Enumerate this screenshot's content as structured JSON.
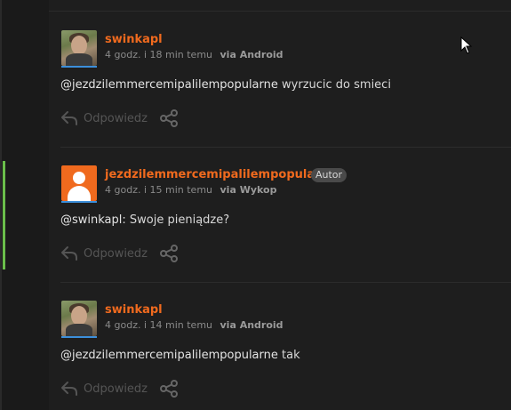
{
  "comments": [
    {
      "username": "swinkapl",
      "time": "4 godz. i 18 min temu",
      "via": "via Android",
      "mention": "@jezdzilemmercemipalilempopularne",
      "text": " wyrzucic do smieci",
      "badge": "",
      "avatar": "photo",
      "reply_label": "Odpowiedz"
    },
    {
      "username": "jezdzilemmercemipalilempopularne",
      "time": "4 godz. i 15 min temu",
      "via": "via Wykop",
      "mention": "@swinkapl",
      "text": ": Swoje pieniądze?",
      "badge": "Autor",
      "avatar": "default",
      "reply_label": "Odpowiedz"
    },
    {
      "username": "swinkapl",
      "time": "4 godz. i 14 min temu",
      "via": "via Android",
      "mention": "@jezdzilemmercemipalilempopularne",
      "text": " tak",
      "badge": "",
      "avatar": "photo",
      "reply_label": "Odpowiedz"
    }
  ],
  "icons": {
    "reply": "reply-arrow-icon",
    "share": "share-icon",
    "cursor": "mouse-pointer-icon"
  },
  "colors": {
    "username": "#f06a1e",
    "highlight": "#6abf4b",
    "avatar_underline": "#3c8fdb",
    "background": "#1a1a1a"
  }
}
